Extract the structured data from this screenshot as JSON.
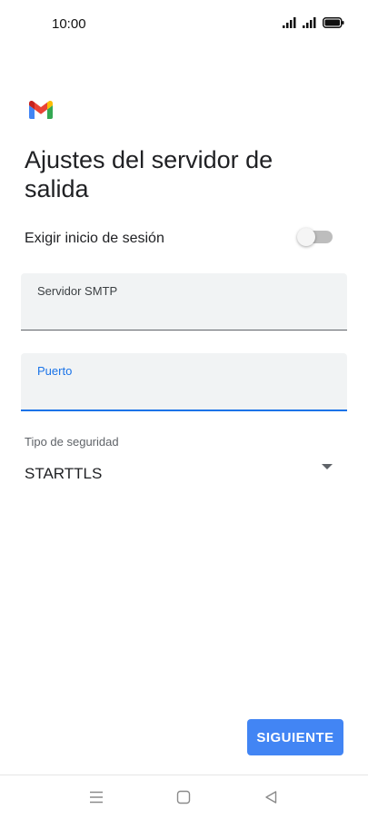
{
  "status_bar": {
    "time": "10:00",
    "icons": [
      "signal-icon",
      "signal-icon",
      "battery-icon"
    ]
  },
  "app": {
    "logo": "gmail-logo",
    "brand_colors": {
      "red": "#ea4335",
      "blue": "#4285f4",
      "green": "#34a853",
      "yellow": "#fbbc04"
    }
  },
  "page": {
    "title": "Ajustes del servidor de salida"
  },
  "require_login": {
    "label": "Exigir inicio de sesión",
    "enabled": false
  },
  "smtp_server": {
    "label": "Servidor SMTP",
    "value": ""
  },
  "port": {
    "label": "Puerto",
    "value": "",
    "focused": true
  },
  "security": {
    "label": "Tipo de seguridad",
    "selected": "STARTTLS"
  },
  "next_button": {
    "label": "SIGUIENTE"
  },
  "nav_bar": {
    "items": [
      "menu-icon",
      "home-icon",
      "back-icon"
    ]
  },
  "colors": {
    "accent": "#1a73e8",
    "button": "#4285f4"
  }
}
